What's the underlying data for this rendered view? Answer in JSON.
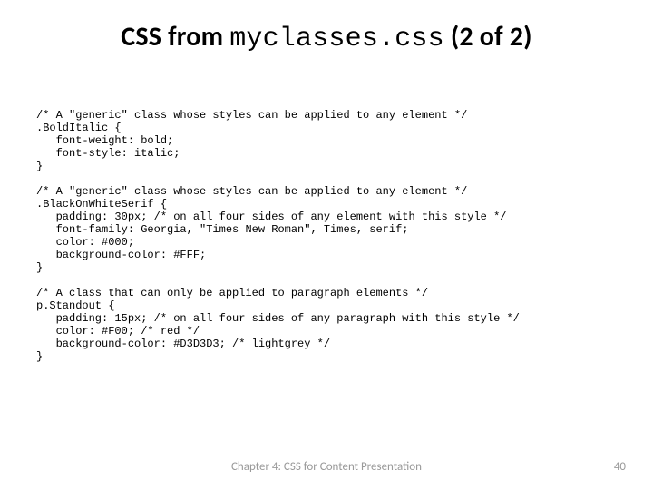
{
  "title": {
    "prefix": "CSS from ",
    "monospaced": "myclasses.css",
    "suffix": " (2 of 2)"
  },
  "code": "/* A \"generic\" class whose styles can be applied to any element */\n.BoldItalic {\n   font-weight: bold;\n   font-style: italic;\n}\n\n/* A \"generic\" class whose styles can be applied to any element */\n.BlackOnWhiteSerif {\n   padding: 30px; /* on all four sides of any element with this style */\n   font-family: Georgia, \"Times New Roman\", Times, serif;\n   color: #000;\n   background-color: #FFF;\n}\n\n/* A class that can only be applied to paragraph elements */\np.Standout {\n   padding: 15px; /* on all four sides of any paragraph with this style */\n   color: #F00; /* red */\n   background-color: #D3D3D3; /* lightgrey */\n}",
  "footer": {
    "center": "Chapter 4: CSS for Content Presentation",
    "page": "40"
  }
}
